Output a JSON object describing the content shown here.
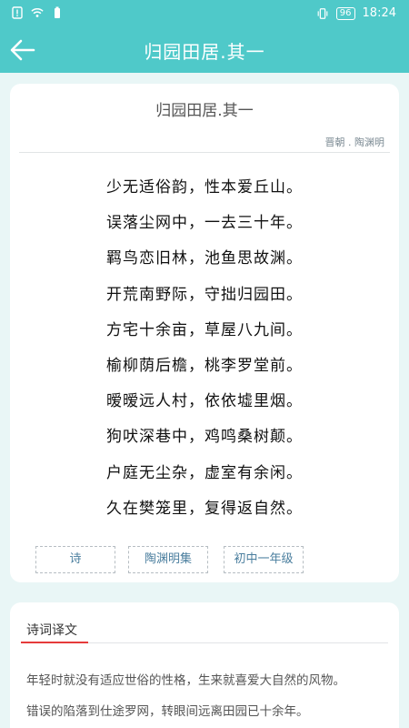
{
  "status_bar": {
    "battery": "96",
    "time": "18:24"
  },
  "app_bar": {
    "title": "归园田居.其一",
    "back_icon": "back-arrow-icon"
  },
  "poem": {
    "title": "归园田居.其一",
    "author": "晋朝 . 陶渊明",
    "lines": [
      "少无适俗韵，性本爱丘山。",
      "误落尘网中，一去三十年。",
      "羁鸟恋旧林，池鱼思故渊。",
      "开荒南野际，守拙归园田。",
      "方宅十余亩，草屋八九间。",
      "榆柳荫后檐，桃李罗堂前。",
      "暧暧远人村，依依墟里烟。",
      "狗吠深巷中，鸡鸣桑树颠。",
      "户庭无尘杂，虚室有余闲。",
      "久在樊笼里，复得返自然。"
    ],
    "tags": [
      "诗",
      "陶渊明集",
      "初中一年级"
    ]
  },
  "translation": {
    "section_title": "诗词译文",
    "lines": [
      "年轻时就没有适应世俗的性格，生来就喜爱大自然的风物。",
      "错误的陷落到仕途罗网，转眼间远离田园已十余年。"
    ]
  },
  "colors": {
    "accent": "#4fc9c9",
    "tag_text": "#4a7e9e",
    "underline": "#e53b3b"
  }
}
